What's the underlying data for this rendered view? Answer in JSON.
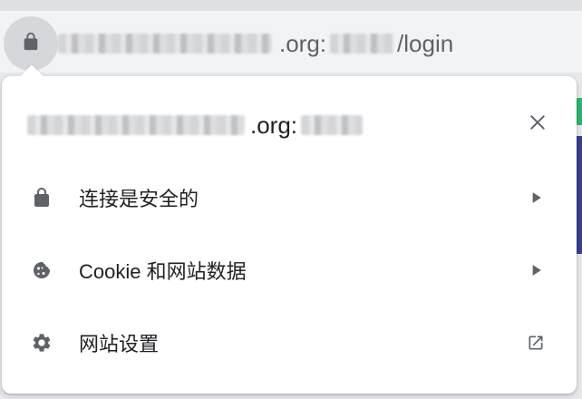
{
  "address_bar": {
    "url_domain_suffix": ".org:",
    "url_path": "/login"
  },
  "popup": {
    "header_domain_suffix": ".org:",
    "rows": [
      {
        "label": "连接是安全的",
        "icon": "lock-icon",
        "trailing_icon": "chevron-right-icon"
      },
      {
        "label": "Cookie 和网站数据",
        "icon": "cookie-icon",
        "trailing_icon": "chevron-right-icon"
      },
      {
        "label": "网站设置",
        "icon": "gear-icon",
        "trailing_icon": "open-in-new-icon"
      }
    ]
  },
  "colors": {
    "icon": "#5f6368",
    "text": "#202124",
    "chip": "#d5d7db"
  }
}
